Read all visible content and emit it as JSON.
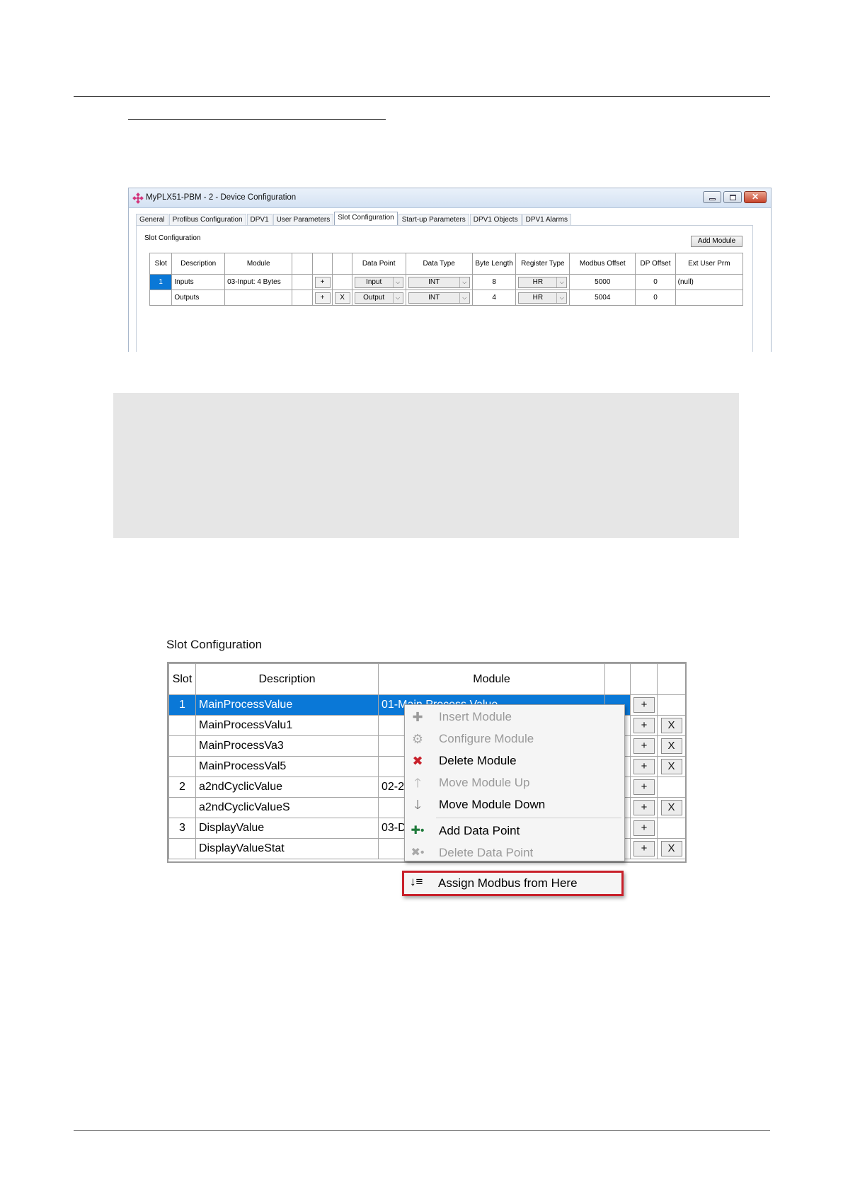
{
  "window": {
    "title": "MyPLX51-PBM - 2 - Device Configuration",
    "close_glyph": "✕",
    "tabs": [
      "General",
      "Profibus Configuration",
      "DPV1",
      "User Parameters",
      "Slot Configuration",
      "Start-up Parameters",
      "DPV1 Objects",
      "DPV1 Alarms"
    ],
    "panel_label": "Slot Configuration",
    "add_module_label": "Add Module",
    "columns": [
      "Slot",
      "Description",
      "Module",
      "",
      "",
      "",
      "Data Point",
      "Data Type",
      "Byte Length",
      "Register Type",
      "Modbus Offset",
      "DP Offset",
      "Ext User Prm"
    ],
    "rows": [
      {
        "slot": "1",
        "description": "Inputs",
        "module": "03-Input: 4 Bytes",
        "plus": "+",
        "x": "",
        "data_point": "Input",
        "data_type": "INT",
        "byte_length": "8",
        "register_type": "HR",
        "modbus_offset": "5000",
        "dp_offset": "0",
        "ext_user_prm": "(null)"
      },
      {
        "slot": "",
        "description": "Outputs",
        "module": "",
        "plus": "+",
        "x": "X",
        "data_point": "Output",
        "data_type": "INT",
        "byte_length": "4",
        "register_type": "HR",
        "modbus_offset": "5004",
        "dp_offset": "0",
        "ext_user_prm": ""
      }
    ]
  },
  "slot_config": {
    "label": "Slot Configuration",
    "columns": [
      "Slot",
      "Description",
      "Module",
      "",
      "",
      ""
    ],
    "rows": [
      {
        "slot": "1",
        "description": "MainProcessValue",
        "module": "01-Main Process Value",
        "plus": "+",
        "x": ""
      },
      {
        "slot": "",
        "description": "MainProcessValu1",
        "module": "",
        "plus": "+",
        "x": "X"
      },
      {
        "slot": "",
        "description": "MainProcessVa3",
        "module": "",
        "plus": "+",
        "x": "X"
      },
      {
        "slot": "",
        "description": "MainProcessVal5",
        "module": "",
        "plus": "+",
        "x": "X"
      },
      {
        "slot": "2",
        "description": "a2ndCyclicValue",
        "module": "02-2",
        "plus": "+",
        "x": ""
      },
      {
        "slot": "",
        "description": "a2ndCyclicValueS",
        "module": "",
        "plus": "+",
        "x": "X"
      },
      {
        "slot": "3",
        "description": "DisplayValue",
        "module": "03-D",
        "plus": "+",
        "x": ""
      },
      {
        "slot": "",
        "description": "DisplayValueStat",
        "module": "",
        "plus": "+",
        "x": "X"
      }
    ]
  },
  "context_menu": {
    "items": [
      {
        "label": "Insert Module",
        "icon": "✚",
        "enabled": false
      },
      {
        "label": "Configure Module",
        "icon": "⚙",
        "enabled": false
      },
      {
        "label": "Delete Module",
        "icon": "✖",
        "enabled": true
      },
      {
        "label": "Move Module Up",
        "icon": "🡑",
        "enabled": false
      },
      {
        "label": "Move Module Down",
        "icon": "🡓",
        "enabled": true
      },
      {
        "label": "Add Data Point",
        "icon": "✚•",
        "enabled": true
      },
      {
        "label": "Delete Data Point",
        "icon": "✖•",
        "enabled": false
      }
    ],
    "highlighted": {
      "label": "Assign Modbus from Here",
      "icon": "↓≡"
    }
  },
  "colors": {
    "selection": "#0a78d7",
    "highlight_border": "#c8202a",
    "delete_icon": "#c8202a",
    "add_icon": "#1e7a3a"
  }
}
